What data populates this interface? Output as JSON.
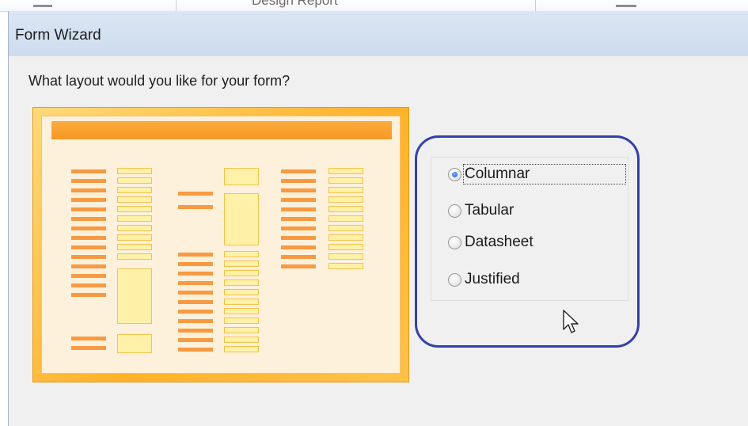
{
  "background_window": {
    "ribbon_text": "Design  Report"
  },
  "dialog": {
    "title": "Form Wizard",
    "prompt": "What layout would you like for your form?",
    "preview_icon": "columnar-layout-preview"
  },
  "layout_options": [
    {
      "label": "Columnar",
      "accel": "C",
      "selected": true
    },
    {
      "label": "Tabular",
      "accel": "T",
      "selected": false
    },
    {
      "label": "Datasheet",
      "accel": "D",
      "selected": false
    },
    {
      "label": "Justified",
      "accel": "J",
      "selected": false
    }
  ],
  "colors": {
    "highlight_circle": "#3440a8",
    "preview_accent": "#f79824"
  },
  "icons": {
    "cursor": "mouse-pointer-icon"
  }
}
